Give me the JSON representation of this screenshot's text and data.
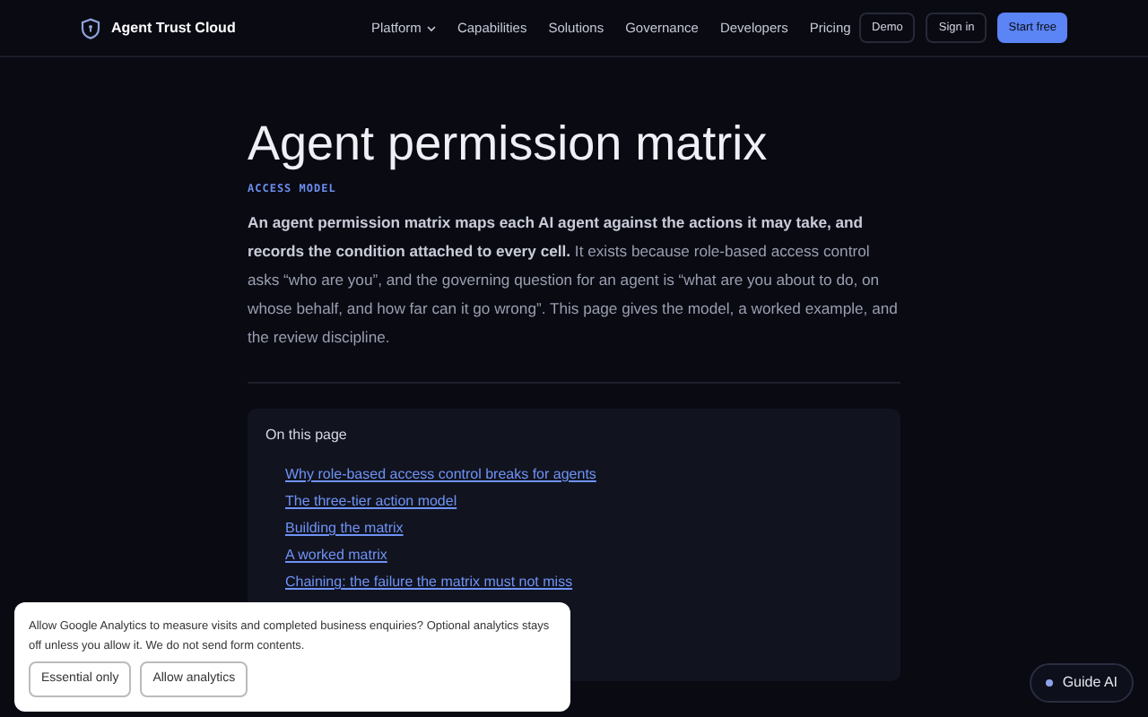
{
  "header": {
    "brand": "Agent Trust Cloud",
    "nav": [
      {
        "label": "Platform",
        "kind": "dropdown"
      },
      {
        "label": "Capabilities",
        "kind": "link"
      },
      {
        "label": "Solutions",
        "kind": "link"
      },
      {
        "label": "Governance",
        "kind": "link"
      },
      {
        "label": "Developers",
        "kind": "link"
      },
      {
        "label": "Pricing",
        "kind": "link"
      }
    ],
    "actions": [
      {
        "label": "Demo",
        "kind": "outline"
      },
      {
        "label": "Sign in",
        "kind": "outline"
      },
      {
        "label": "Start free",
        "kind": "primary"
      }
    ]
  },
  "article": {
    "title": "Agent permission matrix",
    "eyebrow": "ACCESS MODEL",
    "intro": "**An agent permission matrix maps each AI agent against the actions it may take, and records the condition attached to every cell.** It exists because role-based access control asks “who are you”, and the governing question for an agent is “what are you about to do, on whose behalf, and how far can it go wrong”. This page gives the model, a worked example, and the review discipline."
  },
  "toc": {
    "heading": "On this page",
    "links": [
      "Why role-based access control breaks for agents",
      "The three-tier action model",
      "Building the matrix",
      "A worked matrix",
      "Chaining: the failure the matrix must not miss"
    ]
  },
  "cookie_banner": {
    "text": "Allow Google Analytics to measure visits and completed business enquiries? Optional analytics stays off unless you allow it. We do not send form contents.",
    "buttons": [
      "Essential only",
      "Allow analytics"
    ]
  },
  "assistant": {
    "label": "Guide AI"
  }
}
